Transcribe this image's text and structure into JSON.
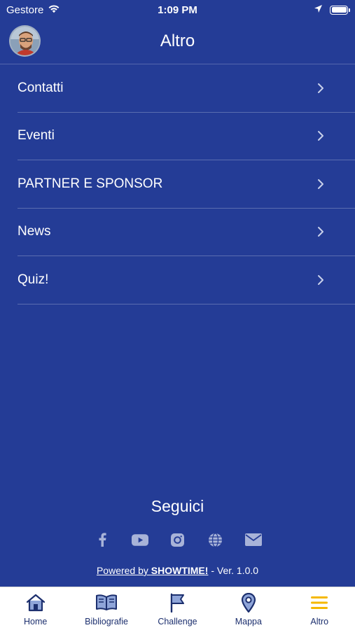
{
  "status_bar": {
    "carrier": "Gestore",
    "time": "1:09 PM"
  },
  "header": {
    "title": "Altro"
  },
  "menu": {
    "items": [
      {
        "label": "Contatti"
      },
      {
        "label": "Eventi"
      },
      {
        "label": "PARTNER E SPONSOR"
      },
      {
        "label": "News"
      },
      {
        "label": "Quiz!"
      }
    ]
  },
  "follow": {
    "title": "Seguici",
    "icons": [
      "facebook-icon",
      "youtube-icon",
      "instagram-icon",
      "globe-icon",
      "mail-icon"
    ]
  },
  "footer": {
    "powered_prefix": "Powered by ",
    "powered_brand": "SHOWTIME!",
    "version": " - Ver. 1.0.0"
  },
  "tabs": [
    {
      "label": "Home",
      "icon": "home-icon"
    },
    {
      "label": "Bibliografie",
      "icon": "book-icon"
    },
    {
      "label": "Challenge",
      "icon": "flag-icon"
    },
    {
      "label": "Mappa",
      "icon": "map-pin-icon"
    },
    {
      "label": "Altro",
      "icon": "menu-icon",
      "active": true
    }
  ],
  "colors": {
    "background": "#243c96",
    "tab_icon": "#1c2f6e",
    "active_tab_icon": "#f5b800"
  }
}
